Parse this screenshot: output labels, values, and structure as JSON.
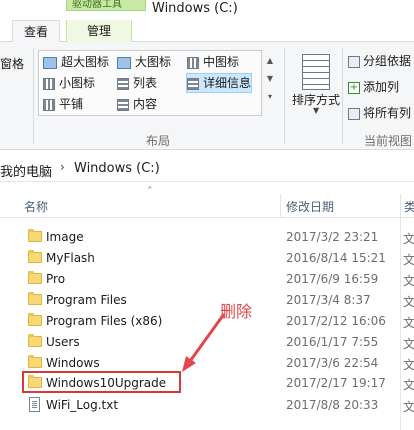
{
  "title_bar": {
    "context_tab_label": "驱动器工具",
    "window_title": "Windows (C:)"
  },
  "tabs": {
    "view": "查看",
    "manage": "管理"
  },
  "ribbon": {
    "left_fragment": "窗格",
    "layout_options": [
      "超大图标",
      "大图标",
      "中图标",
      "小图标",
      "列表",
      "详细信息",
      "平铺",
      "内容"
    ],
    "selected_layout": "详细信息",
    "layout_group_label": "布局",
    "sort_label": "排序方式",
    "right_items": [
      "分组依据",
      "添加列",
      "将所有列"
    ],
    "current_view_group_label": "当前视图"
  },
  "address": {
    "crumbs": [
      "我的电脑",
      "Windows (C:)"
    ]
  },
  "columns": {
    "name": "名称",
    "date": "修改日期",
    "type": "类"
  },
  "files": [
    {
      "name": "Image",
      "date": "2017/3/2 23:21",
      "type": "文",
      "kind": "folder"
    },
    {
      "name": "MyFlash",
      "date": "2016/8/14 15:21",
      "type": "文",
      "kind": "folder"
    },
    {
      "name": "Pro",
      "date": "2017/6/9 16:59",
      "type": "文",
      "kind": "folder"
    },
    {
      "name": "Program Files",
      "date": "2017/3/4 8:37",
      "type": "文",
      "kind": "folder"
    },
    {
      "name": "Program Files (x86)",
      "date": "2017/2/12 16:06",
      "type": "文",
      "kind": "folder"
    },
    {
      "name": "Users",
      "date": "2016/1/17 7:55",
      "type": "文",
      "kind": "folder"
    },
    {
      "name": "Windows",
      "date": "2017/3/6 22:54",
      "type": "文",
      "kind": "folder"
    },
    {
      "name": "Windows10Upgrade",
      "date": "2017/2/17 19:17",
      "type": "文",
      "kind": "folder"
    },
    {
      "name": "WiFi_Log.txt",
      "date": "2017/8/8 20:33",
      "type": "文",
      "kind": "text"
    }
  ],
  "annotation": {
    "label": "删除",
    "color": "#e2454a"
  }
}
